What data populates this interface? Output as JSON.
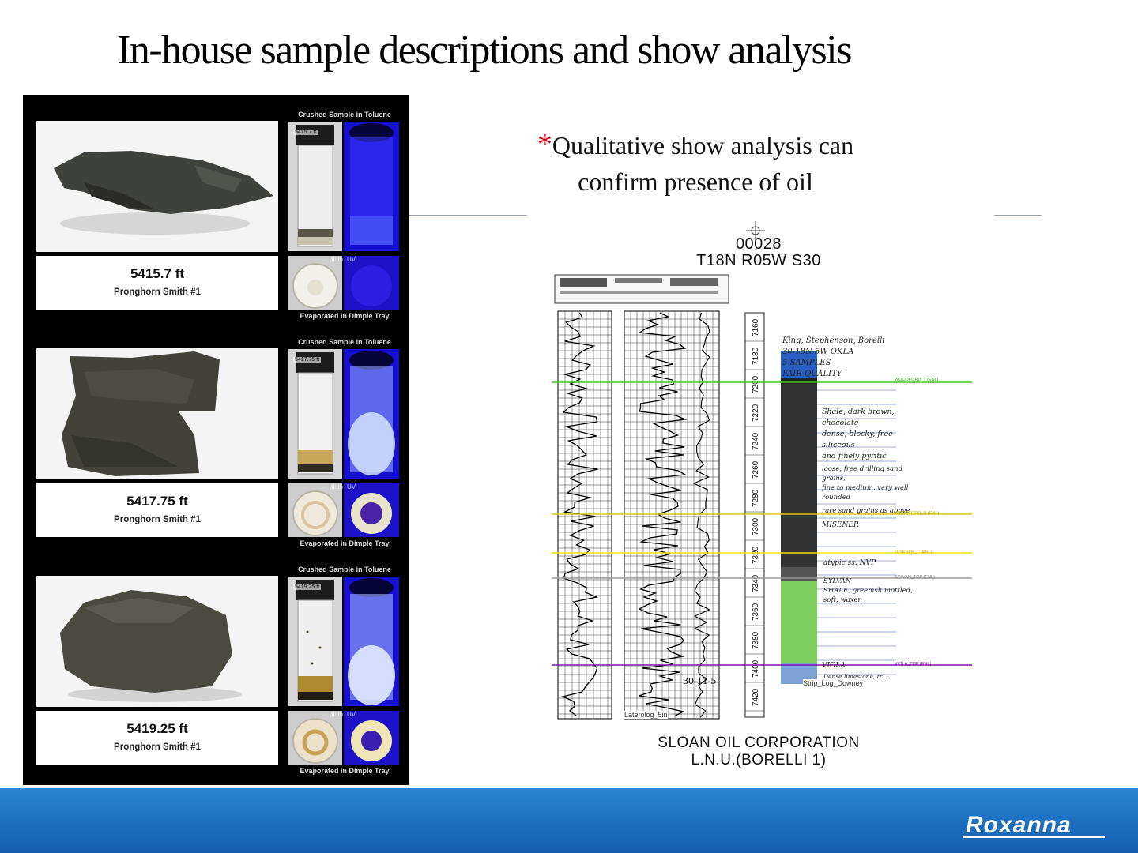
{
  "slide": {
    "title": "In-house sample descriptions and show analysis"
  },
  "samples": [
    {
      "depth": "5415.7  ft",
      "well": "Pronghorn Smith #1",
      "vial_label": "5415.7 ft",
      "crushed_caption": "Crushed Sample in Toluene",
      "evaporated_caption": "Evaporated in Dimple Tray",
      "plain_tag": "plain",
      "uv_tag": "UV",
      "uv_fluorescence": "dim"
    },
    {
      "depth": "5417.75  ft",
      "well": "Pronghorn Smith #1",
      "vial_label": "5417.75 ft",
      "crushed_caption": "Crushed Sample in Toluene",
      "evaporated_caption": "Evaporated in Dimple Tray",
      "plain_tag": "plain",
      "uv_tag": "UV",
      "uv_fluorescence": "bright"
    },
    {
      "depth": "5419.25  ft",
      "well": "Pronghorn Smith #1",
      "vial_label": "5419.25 ft",
      "crushed_caption": "Crushed Sample in Toluene",
      "evaporated_caption": "Evaporated in Dimple Tray",
      "plain_tag": "plain",
      "uv_tag": "UV",
      "uv_fluorescence": "bright"
    }
  ],
  "note": {
    "asterisk": "*",
    "line1": "Qualitative show analysis can",
    "line2": "confirm presence of oil"
  },
  "log": {
    "api_number": "00028",
    "location": "T18N R05W S30",
    "depth_ticks": [
      "7160",
      "7180",
      "7200",
      "7220",
      "7240",
      "7260",
      "7280",
      "7300",
      "7320",
      "7340",
      "7360",
      "7380",
      "7400",
      "7420"
    ],
    "left_track_label": "Laterolog_5in",
    "strip_label": "Strip_Log_Downey",
    "date_stamp": "30-11-5",
    "handwritten_notes": [
      "King, Stephenson, Borelli",
      "30-18N-5W OKLA",
      "5 SAMPLES",
      "FAIR QUALITY",
      "Shale, dark brown, chocolate",
      "dense, blocky, free siliceous",
      "and finely pyritic",
      "loose, free drilling sand grains,",
      "fine to medium, very well rounded",
      "rare sand grains as above",
      "MISENER",
      "atypic ss. NVP",
      "SYLVAN",
      "SHALE, greenish mottled,",
      "soft, waxen",
      "VIOLA",
      "Dense limestone, tr..."
    ],
    "tops": [
      {
        "label": "WOODFORD_T (ENL)",
        "color": "#4cc11f"
      },
      {
        "label": "WOODFORD_D (ENL)",
        "color": "#d9c81a"
      },
      {
        "label": "MISENER_T (ENL)",
        "color": "#e9e21a"
      },
      {
        "label": "SYLVAN_TOP (ENL)",
        "color": "#9a9a9a"
      },
      {
        "label": "VIOLA_TOP (ENL)",
        "color": "#7a16a8"
      }
    ],
    "company": "SLOAN OIL CORPORATION",
    "well_name": "L.N.U.(BORELLI 1)"
  },
  "footer": {
    "brand": "Roxanna"
  }
}
